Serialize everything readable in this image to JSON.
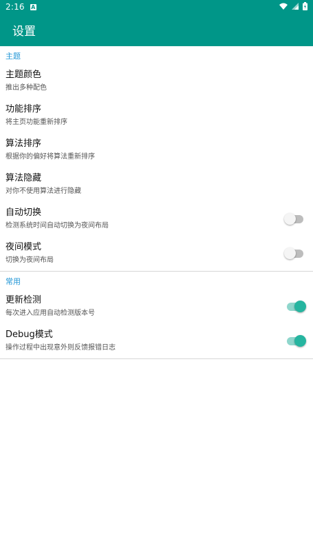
{
  "status_bar": {
    "time": "2:16",
    "notification_badge": "A",
    "icons": [
      "wifi-icon",
      "signal-icon",
      "battery-icon"
    ]
  },
  "toolbar": {
    "title": "设置"
  },
  "colors": {
    "accent": "#009688",
    "section_header": "#2196d6",
    "switch_on": "#26b5a0"
  },
  "sections": [
    {
      "header": "主题",
      "items": [
        {
          "title": "主题颜色",
          "summary": "推出多种配色"
        },
        {
          "title": "功能排序",
          "summary": "将主页功能重新排序"
        },
        {
          "title": "算法排序",
          "summary": "根据你的偏好将算法重新排序"
        },
        {
          "title": "算法隐藏",
          "summary": "对你不使用算法进行隐藏"
        },
        {
          "title": "自动切换",
          "summary": "检测系统时间自动切换为夜间布局",
          "toggle": false
        },
        {
          "title": "夜间模式",
          "summary": "切换为夜间布局",
          "toggle": false
        }
      ]
    },
    {
      "header": "常用",
      "items": [
        {
          "title": "更新检测",
          "summary": "每次进入应用自动检测版本号",
          "toggle": true
        },
        {
          "title": "Debug模式",
          "summary": "操作过程中出现意外则反馈报错日志",
          "toggle": true
        }
      ]
    }
  ]
}
